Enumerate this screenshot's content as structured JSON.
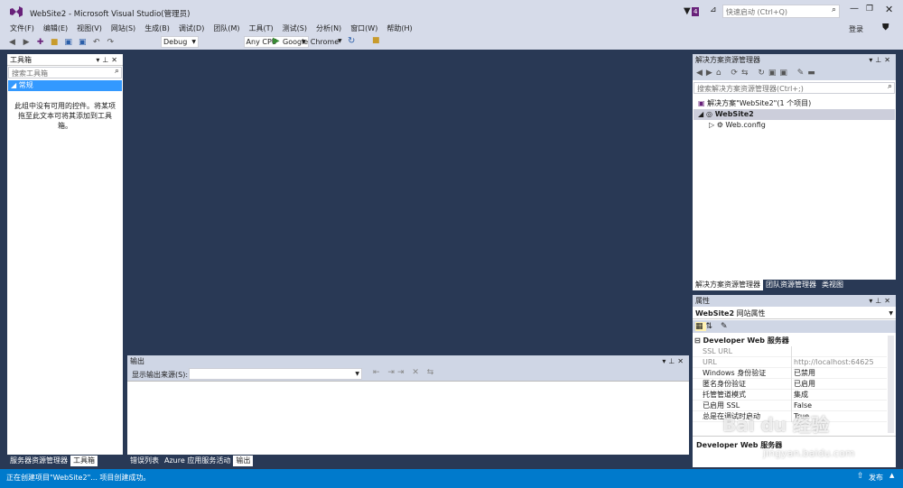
{
  "titlebar": {
    "title": "WebSite2 - Microsoft Visual Studio(管理员)",
    "notif_count": "4",
    "quick_launch": "快速启动 (Ctrl+Q)",
    "signin": "登录"
  },
  "menu": [
    "文件(F)",
    "编辑(E)",
    "视图(V)",
    "网站(S)",
    "生成(B)",
    "调试(D)",
    "团队(M)",
    "工具(T)",
    "测试(S)",
    "分析(N)",
    "窗口(W)",
    "帮助(H)"
  ],
  "toolbar": {
    "config": "Debug",
    "platform": "Any CPU",
    "run_target": "Google Chrome"
  },
  "toolbox": {
    "title": "工具箱",
    "search_placeholder": "搜索工具箱",
    "group": "常规",
    "empty_msg": "此组中没有可用的控件。将某项拖至此文本可将其添加到工具箱。",
    "tabs": [
      "服务器资源管理器",
      "工具箱"
    ]
  },
  "output": {
    "title": "输出",
    "source_label": "显示输出来源(S):",
    "tabs": [
      "错误列表",
      "Azure 应用服务活动",
      "输出"
    ]
  },
  "solution": {
    "title": "解决方案资源管理器",
    "search_placeholder": "搜索解决方案资源管理器(Ctrl+;)",
    "solution_item": "解决方案\"WebSite2\"(1 个项目)",
    "project": "WebSite2",
    "file": "Web.config",
    "tabs": [
      "解决方案资源管理器",
      "团队资源管理器",
      "类视图"
    ]
  },
  "properties": {
    "title": "属性",
    "object": "WebSite2",
    "object_type": "网站属性",
    "category": "Developer Web 服务器",
    "rows": [
      {
        "name": "SSL URL",
        "value": "",
        "disabled": true
      },
      {
        "name": "URL",
        "value": "http://localhost:64625",
        "disabled": true
      },
      {
        "name": "Windows 身份验证",
        "value": "已禁用",
        "disabled": false
      },
      {
        "name": "匿名身份验证",
        "value": "已启用",
        "disabled": false
      },
      {
        "name": "托管管道模式",
        "value": "集成",
        "disabled": false
      },
      {
        "name": "已启用 SSL",
        "value": "False",
        "disabled": false
      },
      {
        "name": "总是在调试时启动",
        "value": "True",
        "disabled": false
      }
    ],
    "desc_title": "Developer Web 服务器"
  },
  "statusbar": {
    "text": "正在创建项目\"WebSite2\"... 项目创建成功。",
    "publish": "发布"
  },
  "watermark": {
    "brand": "Bai du 经验",
    "url": "jingyan.baidu.com"
  },
  "colors": {
    "accent": "#007acc",
    "chrome": "#cfd6e5",
    "doc": "#293955",
    "selected": "#3399ff"
  }
}
